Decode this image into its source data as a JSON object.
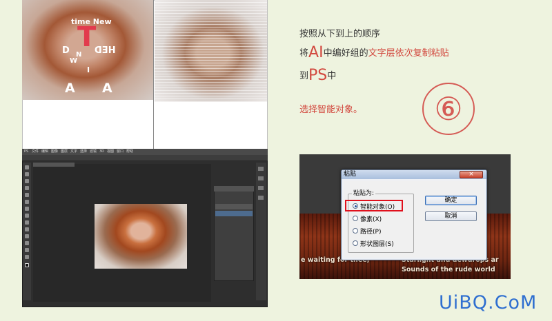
{
  "artboards": {
    "words": {
      "time_new": "time New",
      "big_t": "T",
      "d": "D",
      "n": "N",
      "w": "W",
      "i": "I",
      "hed": "HED",
      "a_left": "A",
      "a_right": "A"
    }
  },
  "photoshop": {
    "menu_items": [
      "PS",
      "文件",
      "编辑",
      "图像",
      "图层",
      "文字",
      "选择",
      "滤镜",
      "3D",
      "视图",
      "窗口",
      "帮助"
    ]
  },
  "instructions": {
    "line1": "按照从下到上的顺序",
    "line2_prefix": "将",
    "line2_ai": "AI",
    "line2_mid": "中编好组的",
    "line2_red": "文字层依次复制粘贴",
    "line3_prefix": "到",
    "line3_ps": "PS",
    "line3_suffix": "中",
    "line4": "选择智能对象。",
    "step_number": "⑥"
  },
  "paste_dialog": {
    "title": "粘贴",
    "close_glyph": "×",
    "group_label": "粘贴为:",
    "options": [
      {
        "label": "智能对象(O)",
        "selected": true
      },
      {
        "label": "像素(X)",
        "selected": false
      },
      {
        "label": "路径(P)",
        "selected": false
      },
      {
        "label": "形状图层(S)",
        "selected": false
      }
    ],
    "ok_label": "确定",
    "cancel_label": "取消",
    "background_text": {
      "line_a": "e waiting for thee,",
      "line_b": "Starlight and dewdrops ar",
      "line_c": "Sounds of the rude world"
    }
  },
  "watermark": "UiBQ.CoM",
  "colors": {
    "accent_red": "#d2483e",
    "background": "#eef3df",
    "highlight_box": "#e0101c",
    "watermark": "#2f6fd0"
  }
}
